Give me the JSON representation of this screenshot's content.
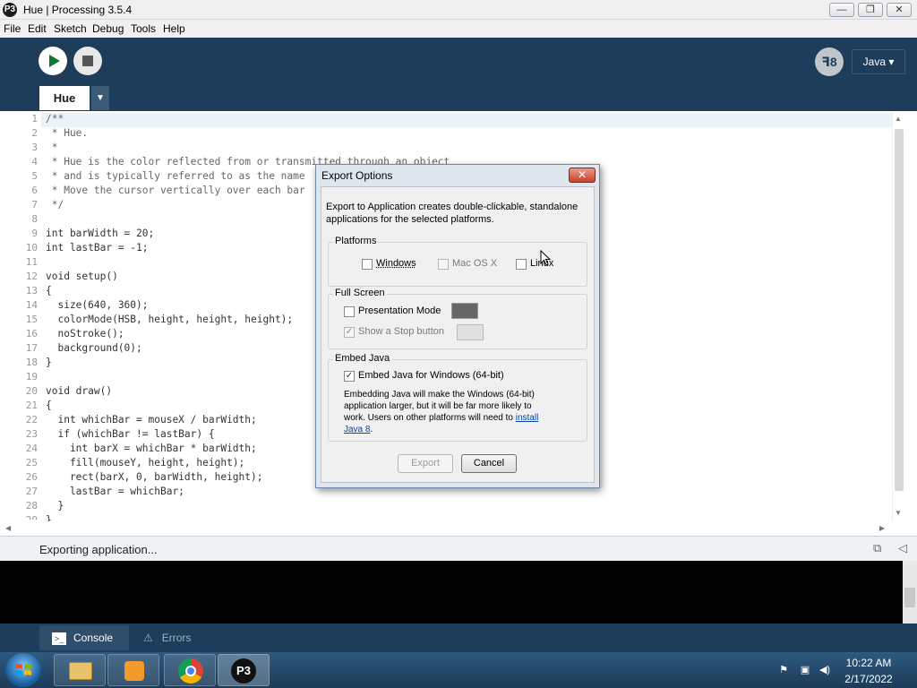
{
  "window": {
    "title": "Hue | Processing 3.5.4",
    "app_icon": "P3",
    "controls": {
      "minimize": "—",
      "maximize": "❐",
      "close": "✕"
    }
  },
  "menu": [
    "File",
    "Edit",
    "Sketch",
    "Debug",
    "Tools",
    "Help"
  ],
  "toolbar": {
    "mode_label": "Java ▾",
    "mode_icon": "ꟻ8"
  },
  "tabs": {
    "active": "Hue",
    "menu_glyph": "▼"
  },
  "editor": {
    "line_numbers": [
      "1",
      "2",
      "3",
      "4",
      "5",
      "6",
      "7",
      "8",
      "9",
      "10",
      "11",
      "12",
      "13",
      "14",
      "15",
      "16",
      "17",
      "18",
      "19",
      "20",
      "21",
      "22",
      "23",
      "24",
      "25",
      "26",
      "27",
      "28",
      "29"
    ],
    "lines": [
      "/**",
      " * Hue.",
      " *",
      " * Hue is the color reflected from or transmitted through an object",
      " * and is typically referred to as the name",
      " * Move the cursor vertically over each bar",
      " */",
      "",
      "int barWidth = 20;",
      "int lastBar = -1;",
      "",
      "void setup()",
      "{",
      "  size(640, 360);",
      "  colorMode(HSB, height, height, height);",
      "  noStroke();",
      "  background(0);",
      "}",
      "",
      "void draw()",
      "{",
      "  int whichBar = mouseX / barWidth;",
      "  if (whichBar != lastBar) {",
      "    int barX = whichBar * barWidth;",
      "    fill(mouseY, height, height);",
      "    rect(barX, 0, barWidth, height);",
      "    lastBar = whichBar;",
      "  }",
      "}"
    ]
  },
  "status": {
    "text": "Exporting application..."
  },
  "bottom_tabs": {
    "console": "Console",
    "errors": "Errors"
  },
  "dialog": {
    "title": "Export Options",
    "close": "✕",
    "intro": "Export to Application creates double-clickable, standalone applications for the selected platforms.",
    "platforms": {
      "label": "Platforms",
      "windows": "Windows",
      "macosx": "Mac OS X",
      "linux": "Linux"
    },
    "fullscreen": {
      "label": "Full Screen",
      "presentation": "Presentation Mode",
      "stop_button": "Show a Stop button",
      "presentation_color": "#666666",
      "stop_color": "#e0e0e0"
    },
    "embed": {
      "label": "Embed Java",
      "checkbox": "Embed Java for Windows (64-bit)",
      "description": "Embedding Java will make the Windows (64-bit) application larger, but it will be far more likely to work. Users on other platforms will need to",
      "link": "install Java 8",
      "link_end": "."
    },
    "buttons": {
      "export": "Export",
      "cancel": "Cancel"
    }
  },
  "taskbar": {
    "time": "10:22 AM",
    "date": "2/17/2022"
  },
  "colors": {
    "ide_bg": "#1d3d5a",
    "keyword": "#e2661a",
    "function": "#006699"
  }
}
